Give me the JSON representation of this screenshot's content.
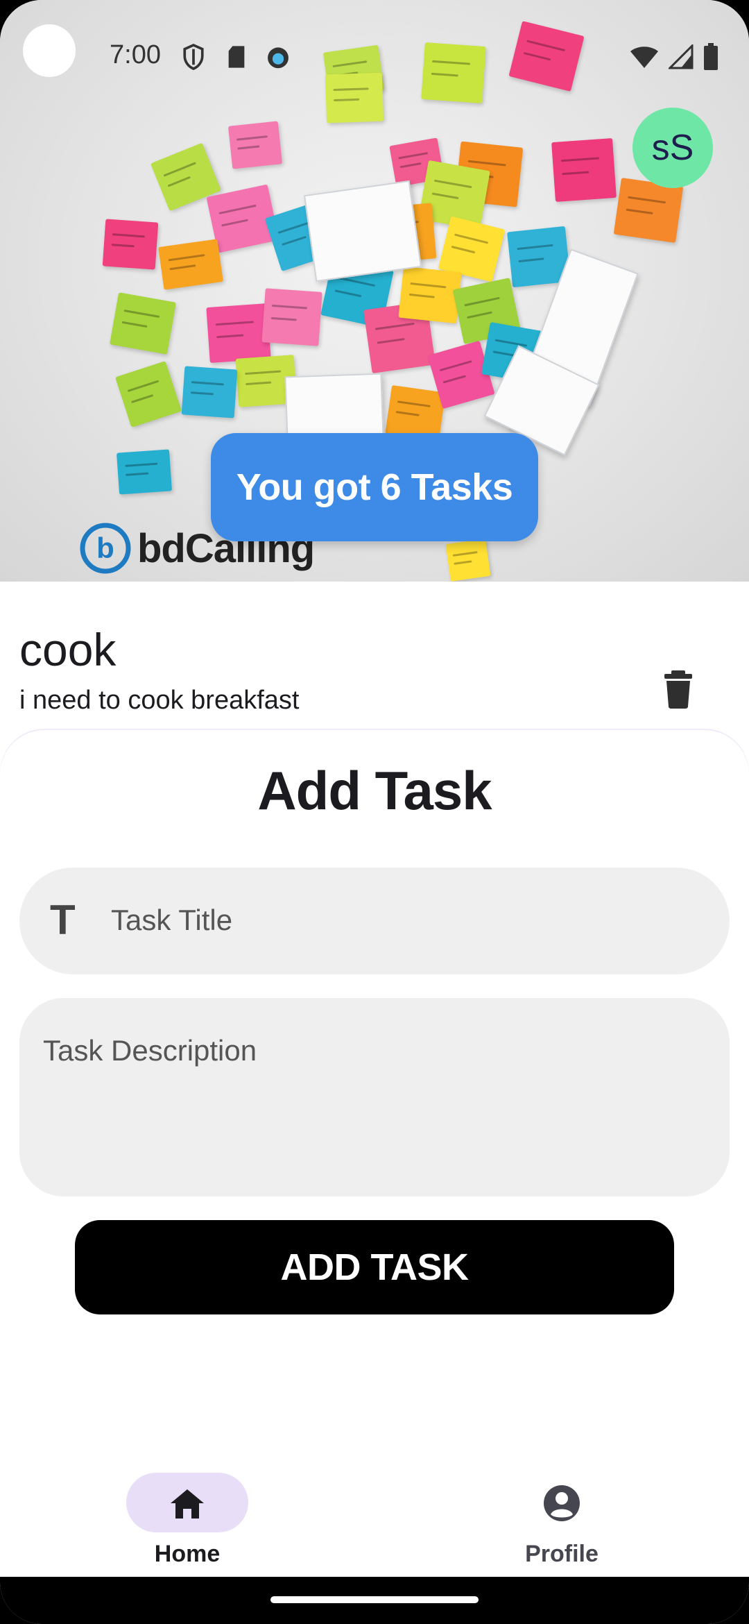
{
  "status_bar": {
    "time": "7:00"
  },
  "header": {
    "avatar_initials": "sS",
    "task_count_label": "You got 6 Tasks",
    "brand_logo_text": "bdCalling"
  },
  "task_list": [
    {
      "title": "cook",
      "description": "i need to cook breakfast",
      "delete_icon": "trash-icon"
    }
  ],
  "add_task_sheet": {
    "title": "Add Task",
    "title_field": {
      "placeholder": "Task Title",
      "value": "",
      "icon": "text-T-icon"
    },
    "description_field": {
      "placeholder": "Task Description",
      "value": ""
    },
    "submit_label": "ADD TASK"
  },
  "bottom_nav": {
    "items": [
      {
        "label": "Home",
        "icon": "home-icon",
        "selected": true
      },
      {
        "label": "Profile",
        "icon": "account-circle-icon",
        "selected": false
      }
    ]
  },
  "colors": {
    "accent_blue": "#3d8be6",
    "avatar_green": "#6ee7a6",
    "nav_selected_pill": "#e8def8",
    "field_bg": "#efefef",
    "button_black": "#000000"
  }
}
